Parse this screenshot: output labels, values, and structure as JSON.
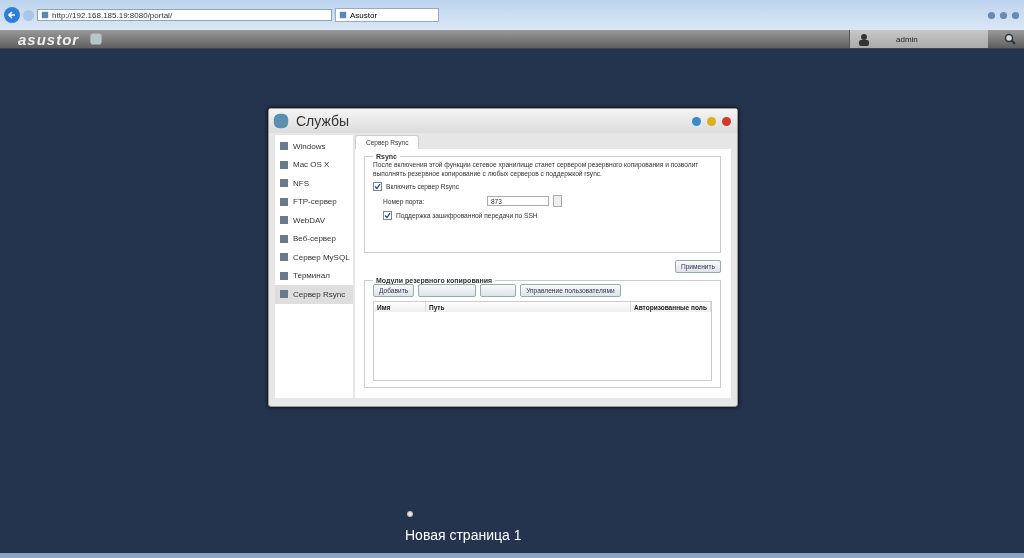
{
  "browser": {
    "address": "http://192.168.185.19:8080/portal/",
    "tab_title": "Asustor"
  },
  "app_bar": {
    "logo": "asustor",
    "user": "admin"
  },
  "dialog": {
    "title": "Службы",
    "sidebar": [
      {
        "label": "Windows",
        "selected": false
      },
      {
        "label": "Mac OS X",
        "selected": false
      },
      {
        "label": "NFS",
        "selected": false
      },
      {
        "label": "FTP-сервер",
        "selected": false
      },
      {
        "label": "WebDAV",
        "selected": false
      },
      {
        "label": "Веб-сервер",
        "selected": false
      },
      {
        "label": "Сервер MySQL",
        "selected": false
      },
      {
        "label": "Терминал",
        "selected": false
      },
      {
        "label": "Сервер Rsync",
        "selected": true
      }
    ],
    "tabs": [
      {
        "label": "Сервер Rsync",
        "selected": true
      }
    ],
    "rsync": {
      "title": "Rsync",
      "description": "После включения этой функции сетевое хранилище станет сервером резервного копирования и позволит выполнять резервное копирование с любых серверов с поддержкой rsync.",
      "enable": {
        "label": "Включить сервер Rsync",
        "checked": true
      },
      "port": {
        "label": "Номер порта:",
        "value": "873"
      },
      "ssh": {
        "label": "Поддержка зашифрованной передачи по SSH",
        "checked": true
      }
    },
    "apply": "Применить",
    "modules": {
      "title": "Модули резервного копирования",
      "buttons": [
        {
          "kind": "text",
          "label": "Добавить"
        },
        {
          "kind": "blank"
        },
        {
          "kind": "blank"
        },
        {
          "kind": "text",
          "label": "Управление пользователями"
        }
      ],
      "columns": [
        "Имя",
        "Путь",
        "Авторизованные поль"
      ]
    }
  },
  "desktop_icon": {
    "label": "Новая страница 1"
  }
}
